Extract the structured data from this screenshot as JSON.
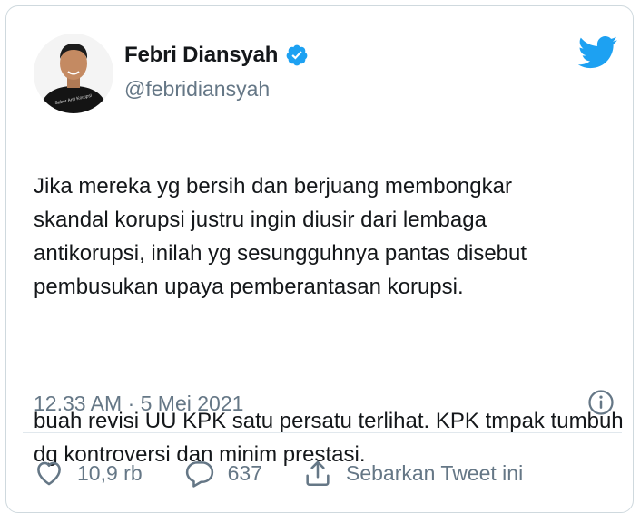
{
  "author": {
    "name": "Febri Diansyah",
    "handle": "@febridiansyah",
    "verified": true,
    "avatar_shirt_text": "Saber Anti Korupsi"
  },
  "tweet": {
    "paragraphs": [
      "Jika mereka yg bersih dan berjuang membongkar skandal korupsi justru ingin diusir dari lembaga antikorupsi, inilah yg sesungguhnya pantas disebut pembusukan upaya pemberantasan korupsi.",
      "buah revisi UU KPK satu persatu terlihat. KPK tmpak tumbuh dg kontroversi dan minim prestasi."
    ],
    "timestamp": "12.33 AM · 5 Mei 2021"
  },
  "actions": {
    "likes": "10,9 rb",
    "replies": "637",
    "share_label": "Sebarkan Tweet ini"
  },
  "colors": {
    "twitter_blue": "#1DA1F2",
    "text_primary": "#14171a",
    "text_secondary": "#657786",
    "border": "#cfd9de"
  },
  "icons": {
    "verified": "verified-badge-icon",
    "brand": "twitter-bird-icon",
    "info": "info-icon",
    "like": "heart-icon",
    "reply": "reply-bubble-icon",
    "share": "share-icon"
  }
}
